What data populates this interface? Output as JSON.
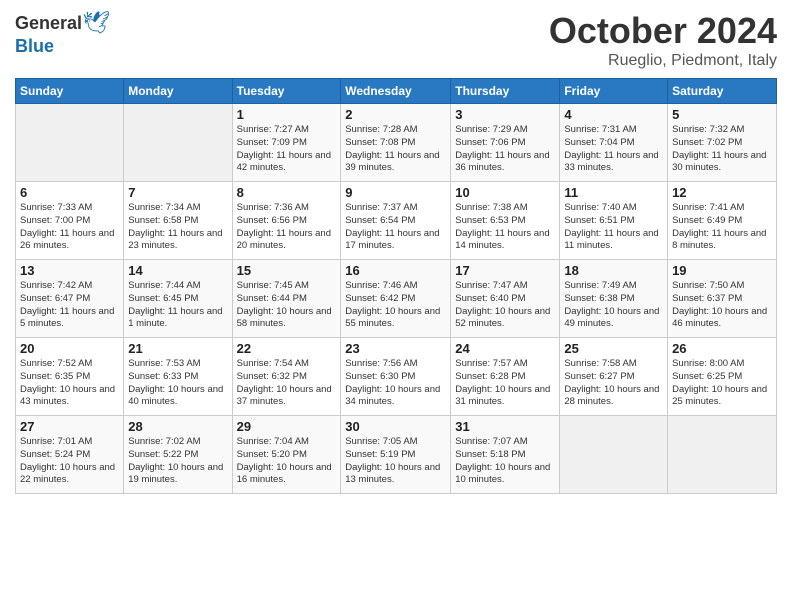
{
  "header": {
    "logo_general": "General",
    "logo_blue": "Blue",
    "month": "October 2024",
    "location": "Rueglio, Piedmont, Italy"
  },
  "days_of_week": [
    "Sunday",
    "Monday",
    "Tuesday",
    "Wednesday",
    "Thursday",
    "Friday",
    "Saturday"
  ],
  "weeks": [
    [
      {
        "day": "",
        "sunrise": "",
        "sunset": "",
        "daylight": "",
        "empty": true
      },
      {
        "day": "",
        "sunrise": "",
        "sunset": "",
        "daylight": "",
        "empty": true
      },
      {
        "day": "1",
        "sunrise": "Sunrise: 7:27 AM",
        "sunset": "Sunset: 7:09 PM",
        "daylight": "Daylight: 11 hours and 42 minutes."
      },
      {
        "day": "2",
        "sunrise": "Sunrise: 7:28 AM",
        "sunset": "Sunset: 7:08 PM",
        "daylight": "Daylight: 11 hours and 39 minutes."
      },
      {
        "day": "3",
        "sunrise": "Sunrise: 7:29 AM",
        "sunset": "Sunset: 7:06 PM",
        "daylight": "Daylight: 11 hours and 36 minutes."
      },
      {
        "day": "4",
        "sunrise": "Sunrise: 7:31 AM",
        "sunset": "Sunset: 7:04 PM",
        "daylight": "Daylight: 11 hours and 33 minutes."
      },
      {
        "day": "5",
        "sunrise": "Sunrise: 7:32 AM",
        "sunset": "Sunset: 7:02 PM",
        "daylight": "Daylight: 11 hours and 30 minutes."
      }
    ],
    [
      {
        "day": "6",
        "sunrise": "Sunrise: 7:33 AM",
        "sunset": "Sunset: 7:00 PM",
        "daylight": "Daylight: 11 hours and 26 minutes."
      },
      {
        "day": "7",
        "sunrise": "Sunrise: 7:34 AM",
        "sunset": "Sunset: 6:58 PM",
        "daylight": "Daylight: 11 hours and 23 minutes."
      },
      {
        "day": "8",
        "sunrise": "Sunrise: 7:36 AM",
        "sunset": "Sunset: 6:56 PM",
        "daylight": "Daylight: 11 hours and 20 minutes."
      },
      {
        "day": "9",
        "sunrise": "Sunrise: 7:37 AM",
        "sunset": "Sunset: 6:54 PM",
        "daylight": "Daylight: 11 hours and 17 minutes."
      },
      {
        "day": "10",
        "sunrise": "Sunrise: 7:38 AM",
        "sunset": "Sunset: 6:53 PM",
        "daylight": "Daylight: 11 hours and 14 minutes."
      },
      {
        "day": "11",
        "sunrise": "Sunrise: 7:40 AM",
        "sunset": "Sunset: 6:51 PM",
        "daylight": "Daylight: 11 hours and 11 minutes."
      },
      {
        "day": "12",
        "sunrise": "Sunrise: 7:41 AM",
        "sunset": "Sunset: 6:49 PM",
        "daylight": "Daylight: 11 hours and 8 minutes."
      }
    ],
    [
      {
        "day": "13",
        "sunrise": "Sunrise: 7:42 AM",
        "sunset": "Sunset: 6:47 PM",
        "daylight": "Daylight: 11 hours and 5 minutes."
      },
      {
        "day": "14",
        "sunrise": "Sunrise: 7:44 AM",
        "sunset": "Sunset: 6:45 PM",
        "daylight": "Daylight: 11 hours and 1 minute."
      },
      {
        "day": "15",
        "sunrise": "Sunrise: 7:45 AM",
        "sunset": "Sunset: 6:44 PM",
        "daylight": "Daylight: 10 hours and 58 minutes."
      },
      {
        "day": "16",
        "sunrise": "Sunrise: 7:46 AM",
        "sunset": "Sunset: 6:42 PM",
        "daylight": "Daylight: 10 hours and 55 minutes."
      },
      {
        "day": "17",
        "sunrise": "Sunrise: 7:47 AM",
        "sunset": "Sunset: 6:40 PM",
        "daylight": "Daylight: 10 hours and 52 minutes."
      },
      {
        "day": "18",
        "sunrise": "Sunrise: 7:49 AM",
        "sunset": "Sunset: 6:38 PM",
        "daylight": "Daylight: 10 hours and 49 minutes."
      },
      {
        "day": "19",
        "sunrise": "Sunrise: 7:50 AM",
        "sunset": "Sunset: 6:37 PM",
        "daylight": "Daylight: 10 hours and 46 minutes."
      }
    ],
    [
      {
        "day": "20",
        "sunrise": "Sunrise: 7:52 AM",
        "sunset": "Sunset: 6:35 PM",
        "daylight": "Daylight: 10 hours and 43 minutes."
      },
      {
        "day": "21",
        "sunrise": "Sunrise: 7:53 AM",
        "sunset": "Sunset: 6:33 PM",
        "daylight": "Daylight: 10 hours and 40 minutes."
      },
      {
        "day": "22",
        "sunrise": "Sunrise: 7:54 AM",
        "sunset": "Sunset: 6:32 PM",
        "daylight": "Daylight: 10 hours and 37 minutes."
      },
      {
        "day": "23",
        "sunrise": "Sunrise: 7:56 AM",
        "sunset": "Sunset: 6:30 PM",
        "daylight": "Daylight: 10 hours and 34 minutes."
      },
      {
        "day": "24",
        "sunrise": "Sunrise: 7:57 AM",
        "sunset": "Sunset: 6:28 PM",
        "daylight": "Daylight: 10 hours and 31 minutes."
      },
      {
        "day": "25",
        "sunrise": "Sunrise: 7:58 AM",
        "sunset": "Sunset: 6:27 PM",
        "daylight": "Daylight: 10 hours and 28 minutes."
      },
      {
        "day": "26",
        "sunrise": "Sunrise: 8:00 AM",
        "sunset": "Sunset: 6:25 PM",
        "daylight": "Daylight: 10 hours and 25 minutes."
      }
    ],
    [
      {
        "day": "27",
        "sunrise": "Sunrise: 7:01 AM",
        "sunset": "Sunset: 5:24 PM",
        "daylight": "Daylight: 10 hours and 22 minutes."
      },
      {
        "day": "28",
        "sunrise": "Sunrise: 7:02 AM",
        "sunset": "Sunset: 5:22 PM",
        "daylight": "Daylight: 10 hours and 19 minutes."
      },
      {
        "day": "29",
        "sunrise": "Sunrise: 7:04 AM",
        "sunset": "Sunset: 5:20 PM",
        "daylight": "Daylight: 10 hours and 16 minutes."
      },
      {
        "day": "30",
        "sunrise": "Sunrise: 7:05 AM",
        "sunset": "Sunset: 5:19 PM",
        "daylight": "Daylight: 10 hours and 13 minutes."
      },
      {
        "day": "31",
        "sunrise": "Sunrise: 7:07 AM",
        "sunset": "Sunset: 5:18 PM",
        "daylight": "Daylight: 10 hours and 10 minutes."
      },
      {
        "day": "",
        "sunrise": "",
        "sunset": "",
        "daylight": "",
        "empty": true
      },
      {
        "day": "",
        "sunrise": "",
        "sunset": "",
        "daylight": "",
        "empty": true
      }
    ]
  ]
}
